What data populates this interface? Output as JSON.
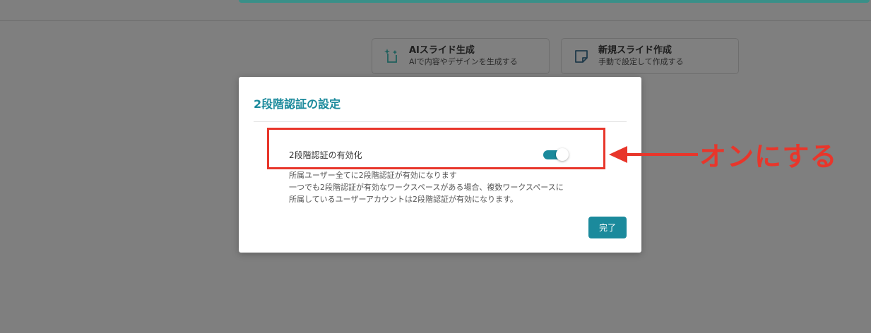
{
  "background": {
    "cards": [
      {
        "title": "AIスライド生成",
        "subtitle": "AIで内容やデザインを生成する",
        "icon": "ai-sparkle-slide-icon"
      },
      {
        "title": "新規スライド作成",
        "subtitle": "手動で設定して作成する",
        "icon": "note-icon"
      }
    ]
  },
  "modal": {
    "title": "2段階認証の設定",
    "setting": {
      "label": "2段階認証の有効化",
      "enabled": true
    },
    "description": [
      "所属ユーザー全てに2段階認証が有効になります",
      "一つでも2段階認証が有効なワークスペースがある場合、複数ワークスペースに",
      "所属しているユーザーアカウントは2段階認証が有効になります。"
    ],
    "done_label": "完了"
  },
  "annotation": {
    "text": "オンにする"
  },
  "colors": {
    "accent": "#1b8a9c",
    "annotation": "#e8362b",
    "overlay": "#7f7f7f"
  }
}
